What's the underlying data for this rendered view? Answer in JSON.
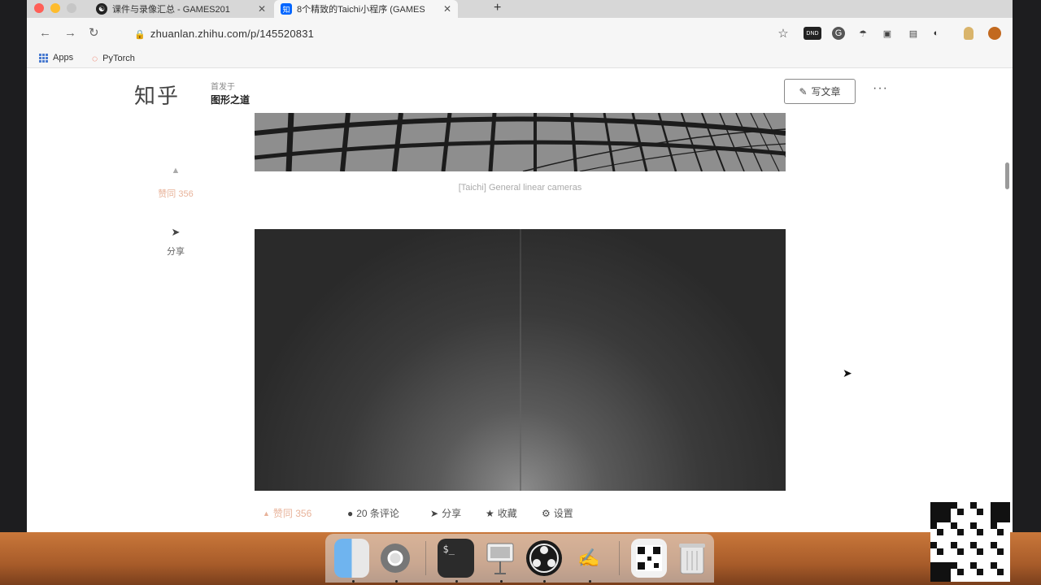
{
  "tabs": [
    {
      "title": "课件与录像汇总 - GAMES201",
      "favicon": "yin-yang-icon"
    },
    {
      "title": "8个精致的Taichi小程序 (GAMES",
      "favicon": "zhihu-icon",
      "favicon_text": "知"
    }
  ],
  "address_bar": {
    "url": "zhuanlan.zhihu.com/p/145520831"
  },
  "bookmarks": [
    {
      "label": "Apps"
    },
    {
      "label": "PyTorch"
    }
  ],
  "extensions": [
    {
      "name": "star-icon",
      "glyph": "☆"
    },
    {
      "name": "dnd-extension-icon",
      "glyph": "DND"
    },
    {
      "name": "grammarly-icon",
      "glyph": "G"
    },
    {
      "name": "umbrella-icon",
      "glyph": "☂"
    },
    {
      "name": "lock-extension-icon",
      "glyph": "▣"
    },
    {
      "name": "puzzle-icon",
      "glyph": "▤"
    },
    {
      "name": "half-circle-icon",
      "glyph": "◐"
    },
    {
      "name": "lightbulb-icon",
      "glyph": "●"
    },
    {
      "name": "profile-icon",
      "glyph": "●"
    }
  ],
  "header": {
    "logo": "知乎",
    "column_label": "首发于",
    "column_name": "图形之道",
    "write_button": "写文章",
    "more": "···"
  },
  "article": {
    "caption": "[Taichi] General linear cameras"
  },
  "sidebar": {
    "like_label": "赞同 356",
    "share_label": "分享"
  },
  "action_bar": {
    "like": "赞同 356",
    "comments": "20 条评论",
    "share": "分享",
    "favorite": "收藏",
    "settings": "设置"
  },
  "colors": {
    "zhihu_blue": "#0066ff",
    "like_faded": "#e8b39a",
    "desktop": "#b86a31"
  }
}
